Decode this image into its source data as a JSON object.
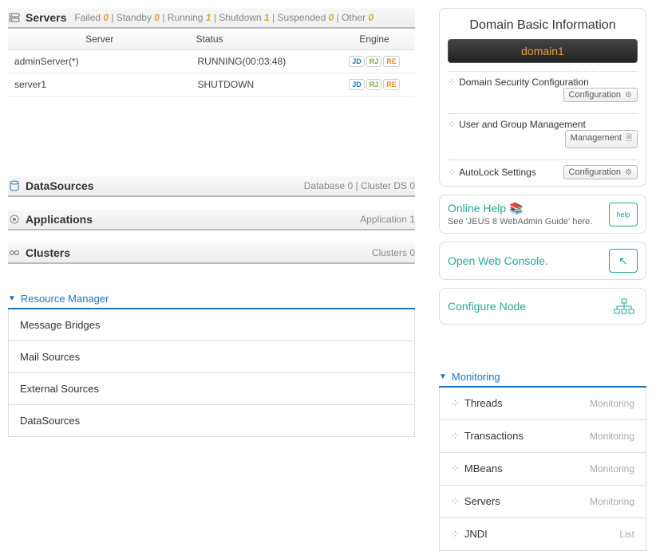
{
  "servers": {
    "title": "Servers",
    "stats": [
      {
        "label": "Failed",
        "value": "0"
      },
      {
        "label": "Standby",
        "value": "0"
      },
      {
        "label": "Running",
        "value": "1"
      },
      {
        "label": "Shutdown",
        "value": "1"
      },
      {
        "label": "Suspended",
        "value": "0"
      },
      {
        "label": "Other",
        "value": "0"
      }
    ],
    "columns": {
      "c1": "Server",
      "c2": "Status",
      "c3": "Engine"
    },
    "rows": [
      {
        "name": "adminServer(*)",
        "status": "RUNNING(00:03:48)"
      },
      {
        "name": "server1",
        "status": "SHUTDOWN"
      }
    ]
  },
  "datasources": {
    "title": "DataSources",
    "r1": "Database",
    "r1v": "0",
    "r2": "Cluster DS",
    "r2v": "0"
  },
  "applications": {
    "title": "Applications",
    "r1": "Application",
    "r1v": "1"
  },
  "clusters": {
    "title": "Clusters",
    "r1": "Clusters",
    "r1v": "0"
  },
  "domain": {
    "heading": "Domain Basic Information",
    "name": "domain1",
    "items": [
      {
        "label": "Domain Security Configuration",
        "btn": "Configuration"
      },
      {
        "label": "User and Group Management",
        "btn": "Management"
      },
      {
        "label": "AutoLock Settings",
        "btn": "Configuration"
      }
    ]
  },
  "help": {
    "title": "Online Help",
    "sub": "See 'JEUS 8 WebAdmin Guide' here."
  },
  "console": {
    "title": "Open Web Console."
  },
  "node": {
    "title": "Configure Node"
  },
  "resmgr": {
    "title": "Resource Manager",
    "items": [
      "Message Bridges",
      "Mail Sources",
      "External Sources",
      "DataSources"
    ]
  },
  "monitoring": {
    "title": "Monitoring",
    "items": [
      {
        "label": "Threads",
        "suffix": "Monitoring"
      },
      {
        "label": "Transactions",
        "suffix": "Monitoring"
      },
      {
        "label": "MBeans",
        "suffix": "Monitoring"
      },
      {
        "label": "Servers",
        "suffix": "Monitoring"
      },
      {
        "label": "JNDI",
        "suffix": "List"
      }
    ]
  }
}
